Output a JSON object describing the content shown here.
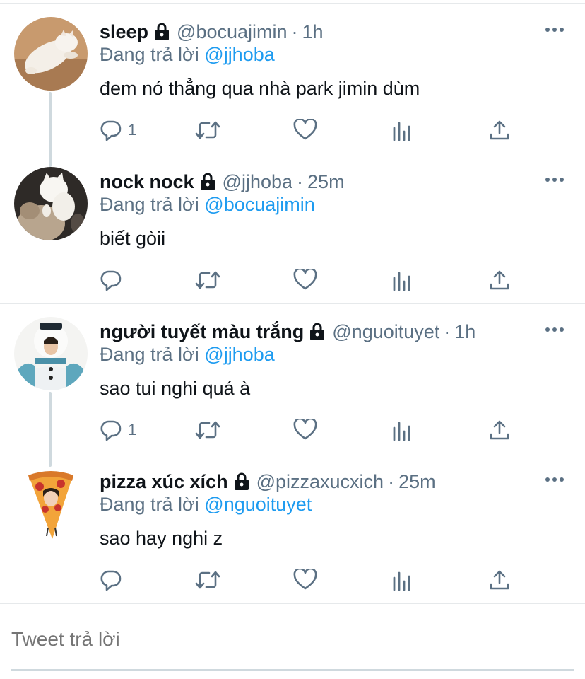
{
  "colors": {
    "text": "#0f1419",
    "secondary": "#5b7083",
    "mention": "#1d9bf0",
    "divider": "#e6e9eb"
  },
  "threads": [
    {
      "tweets": [
        {
          "name": "sleep",
          "handle": "@bocuajimin",
          "separator": "·",
          "time": "1h",
          "reply_prefix": "Đang trả lời",
          "reply_mention": "@jjhoba",
          "text": "đem nó thẳng qua nhà park jimin dùm",
          "reply_count": "1",
          "avatar": "cat-lying-avatar"
        },
        {
          "name": "nock nock",
          "handle": "@jjhoba",
          "separator": "·",
          "time": "25m",
          "reply_prefix": "Đang trả lời",
          "reply_mention": "@bocuajimin",
          "text": "biết gòii",
          "reply_count": "",
          "avatar": "cats-playing-avatar"
        }
      ]
    },
    {
      "tweets": [
        {
          "name": "người tuyết màu trắng",
          "handle": "@nguoituyet",
          "separator": "·",
          "time": "1h",
          "reply_prefix": "Đang trả lời",
          "reply_mention": "@jjhoba",
          "text": "sao tui nghi quá à",
          "reply_count": "1",
          "avatar": "snowman-costume-avatar"
        },
        {
          "name": "pizza xúc xích",
          "handle": "@pizzaxucxich",
          "separator": "·",
          "time": "25m",
          "reply_prefix": "Đang trả lời",
          "reply_mention": "@nguoituyet",
          "text": "sao hay nghi z",
          "reply_count": "",
          "avatar": "pizza-costume-avatar"
        }
      ]
    }
  ],
  "compose": {
    "placeholder": "Tweet trả lời"
  }
}
